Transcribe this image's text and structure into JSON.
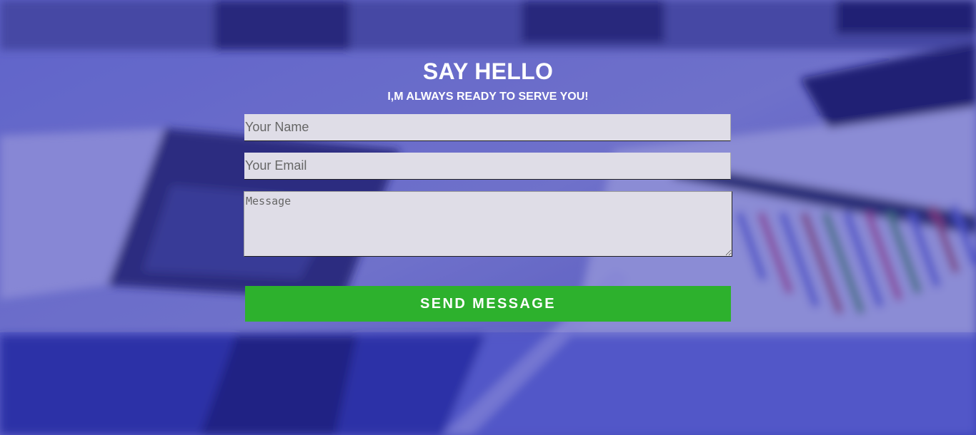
{
  "contact": {
    "heading": "SAY HELLO",
    "subheading": "I,M ALWAYS READY TO SERVE YOU!",
    "name_placeholder": "Your Name",
    "email_placeholder": "Your Email",
    "message_placeholder": "Message",
    "send_label": "SEND MESSAGE"
  },
  "colors": {
    "background_tint": "#2a2f8a",
    "field_background": "#dfdde7",
    "button_background": "#2db12d",
    "heading_text": "#ffffff"
  }
}
